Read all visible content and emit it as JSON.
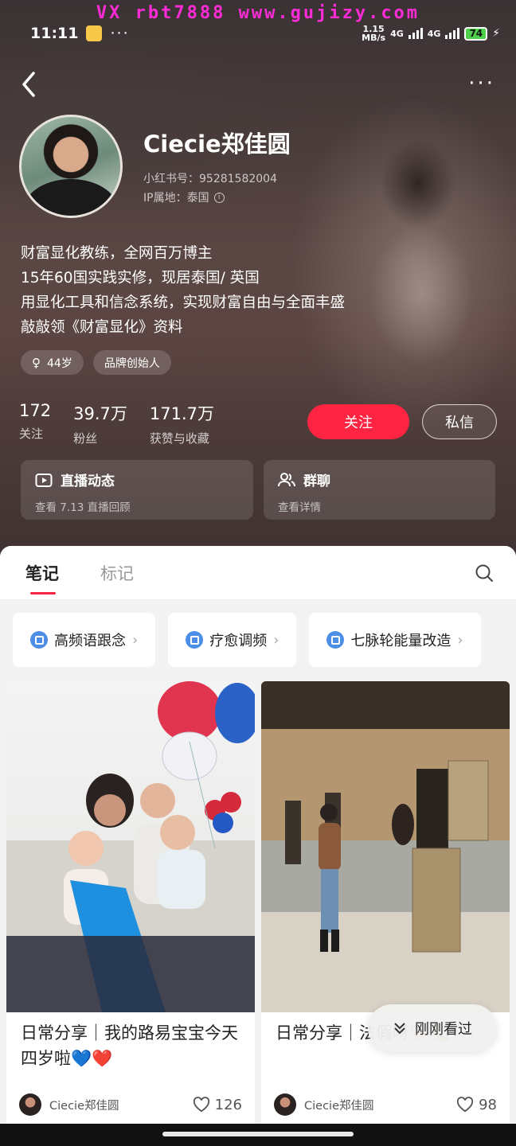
{
  "watermark": "VX rbt7888  www.gujizy.com",
  "status_bar": {
    "time": "11:11",
    "net_speed_value": "1.15",
    "net_speed_unit": "MB/s",
    "network_1": "4G",
    "network_2": "4G",
    "battery": "74"
  },
  "profile": {
    "name": "Ciecie郑佳圆",
    "redbook_id": "小红书号：95281582004",
    "ip_location": "IP属地：泰国",
    "bio": [
      "财富显化教练，全网百万博主",
      "15年60国实践实修，现居泰国/ 英国",
      "用显化工具和信念系统，实现财富自由与全面丰盛",
      "敲敲领《财富显化》资料"
    ],
    "tags": [
      "44岁",
      "品牌创始人"
    ],
    "stats": [
      {
        "value": "172",
        "label": "关注"
      },
      {
        "value": "39.7万",
        "label": "粉丝"
      },
      {
        "value": "171.7万",
        "label": "获赞与收藏"
      }
    ],
    "follow_label": "关注",
    "message_label": "私信",
    "live_card": {
      "title": "直播动态",
      "subtitle": "查看 7.13 直播回顾"
    },
    "group_card": {
      "title": "群聊",
      "subtitle": "查看详情"
    }
  },
  "tabs": [
    "笔记",
    "标记"
  ],
  "collections": [
    "高频语跟念",
    "疗愈调频",
    "七脉轮能量改造"
  ],
  "notes": [
    {
      "title": "日常分享｜我的路易宝宝今天四岁啦💙❤️",
      "author": "Ciecie郑佳圆",
      "likes": "126"
    },
    {
      "title": "日常分享｜法假呀🐎🐛",
      "author": "Ciecie郑佳圆",
      "likes": "98"
    }
  ],
  "recent_label": "刚刚看过",
  "colors": {
    "accent": "#ff2442",
    "collection_icon": "#4c8ee6"
  }
}
